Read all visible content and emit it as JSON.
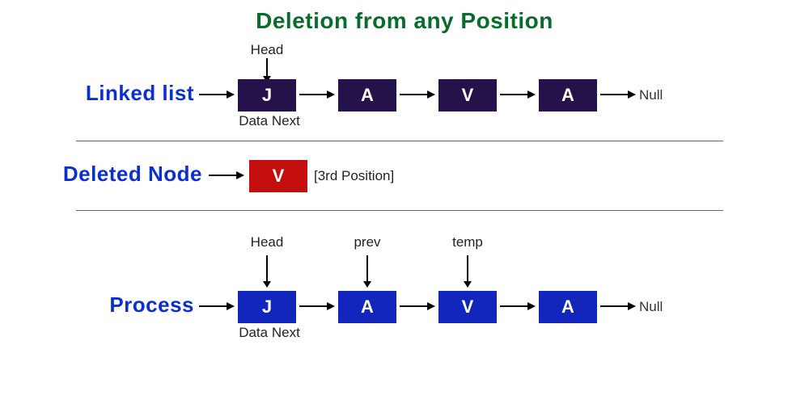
{
  "title": "Deletion from any Position",
  "row1": {
    "label": "Linked list",
    "head_label": "Head",
    "under_label": "Data Next",
    "nodes": [
      "J",
      "A",
      "V",
      "A"
    ],
    "terminator": "Null"
  },
  "row2": {
    "label": "Deleted Node",
    "node": "V",
    "note": "[3rd Position]"
  },
  "row3": {
    "label": "Process",
    "under_label": "Data Next",
    "pointers": [
      "Head",
      "prev",
      "temp"
    ],
    "nodes": [
      "J",
      "A",
      "V",
      "A"
    ],
    "terminator": "Null"
  }
}
